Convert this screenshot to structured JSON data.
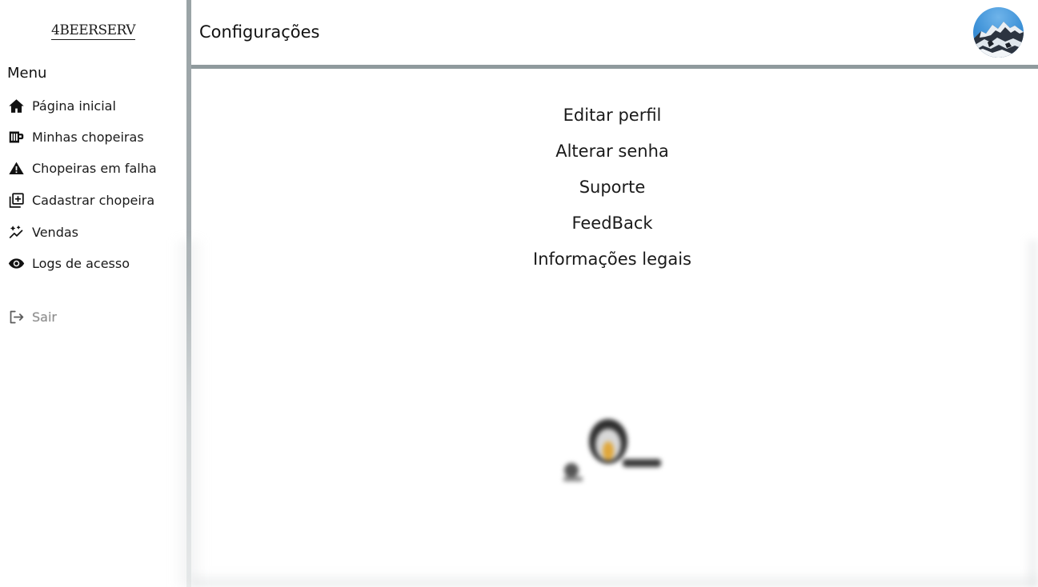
{
  "brand": {
    "name": "4BEERSERV"
  },
  "sidebar": {
    "menu_title": "Menu",
    "items": [
      {
        "label": "Página inicial",
        "icon": "home-icon"
      },
      {
        "label": "Minhas chopeiras",
        "icon": "beer-tap-icon"
      },
      {
        "label": "Chopeiras em falha",
        "icon": "warning-icon"
      },
      {
        "label": "Cadastrar chopeira",
        "icon": "add-box-icon"
      },
      {
        "label": "Vendas",
        "icon": "sparkle-chart-icon"
      },
      {
        "label": "Logs de acesso",
        "icon": "eye-icon"
      }
    ],
    "logout_label": "Sair"
  },
  "header": {
    "title": "Configurações"
  },
  "settings": {
    "items": [
      "Editar perfil",
      "Alterar senha",
      "Suporte",
      "FeedBack",
      "Informações legais"
    ]
  },
  "colors": {
    "divider": "#9aa3a6",
    "header_rule": "#8f9a9d",
    "logout_text": "#8e8e8e"
  }
}
